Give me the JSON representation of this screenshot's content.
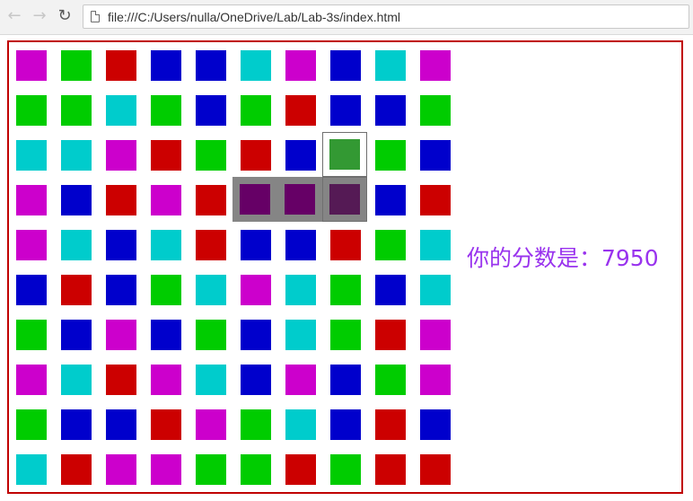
{
  "browser": {
    "back_icon": "back-arrow-icon",
    "forward_icon": "forward-arrow-icon",
    "reload_icon": "reload-icon",
    "url": "file:///C:/Users/nulla/OneDrive/Lab/Lab-3s/index.html"
  },
  "colors": {
    "m": "#cc00cc",
    "g": "#00cc00",
    "r": "#cc0000",
    "b": "#0000cc",
    "c": "#00cccc",
    "matched_tile": "#660066",
    "matched_tile_outlined": "#551a55",
    "selected_tile": "#339933",
    "matched_bg": "#858585",
    "frame_border": "#c00000",
    "score_text": "#9933ee"
  },
  "board": {
    "rows": 10,
    "cols": 10,
    "tiles": [
      [
        "m",
        "g",
        "r",
        "b",
        "b",
        "c",
        "m",
        "b",
        "c",
        "m"
      ],
      [
        "g",
        "g",
        "c",
        "g",
        "b",
        "g",
        "r",
        "b",
        "b",
        "g"
      ],
      [
        "c",
        "c",
        "m",
        "r",
        "g",
        "r",
        "b",
        "selected",
        "g",
        "b"
      ],
      [
        "m",
        "b",
        "r",
        "m",
        "r",
        "matched",
        "matched",
        "matched_outlined",
        "b",
        "r"
      ],
      [
        "m",
        "c",
        "b",
        "c",
        "r",
        "b",
        "b",
        "r",
        "g",
        "c"
      ],
      [
        "b",
        "r",
        "b",
        "g",
        "c",
        "m",
        "c",
        "g",
        "b",
        "c"
      ],
      [
        "g",
        "b",
        "m",
        "b",
        "g",
        "b",
        "c",
        "g",
        "r",
        "m"
      ],
      [
        "m",
        "c",
        "r",
        "m",
        "c",
        "b",
        "m",
        "b",
        "g",
        "m"
      ],
      [
        "g",
        "b",
        "b",
        "r",
        "m",
        "g",
        "c",
        "b",
        "r",
        "b"
      ],
      [
        "c",
        "r",
        "m",
        "m",
        "g",
        "g",
        "r",
        "g",
        "r",
        "r"
      ]
    ]
  },
  "score": {
    "text": "你的分数是：7950"
  }
}
